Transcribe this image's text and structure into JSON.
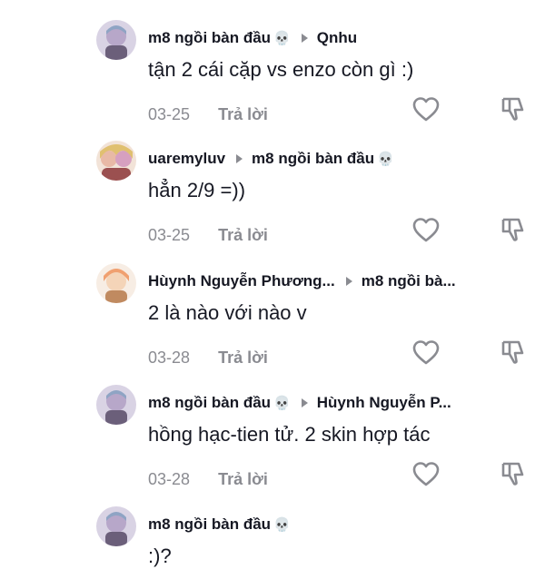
{
  "comments": [
    {
      "author": "m8 ngồi bàn đầu",
      "author_skull": "💀",
      "reply_to": "Qnhu",
      "reply_to_skull": "",
      "text": "tận 2 cái cặp vs enzo còn gì :)",
      "date": "03-25",
      "reply_label": "Trả lời",
      "avatar_color": "#b7a7c9"
    },
    {
      "author": "uaremyluv",
      "author_skull": "",
      "reply_to": "m8 ngồi bàn đầu",
      "reply_to_skull": "💀",
      "text": "hẳn 2/9 =))",
      "date": "03-25",
      "reply_label": "Trả lời",
      "avatar_color": "#e8b9a6"
    },
    {
      "author": "Hùynh Nguyễn Phương...",
      "author_skull": "",
      "reply_to": "m8 ngồi bà...",
      "reply_to_skull": "",
      "text": "2 là nào với nào v",
      "date": "03-28",
      "reply_label": "Trả lời",
      "avatar_color": "#f0c49a"
    },
    {
      "author": "m8 ngồi bàn đầu",
      "author_skull": "💀",
      "reply_to": "Hùynh Nguyễn P...",
      "reply_to_skull": "",
      "text": "hồng hạc-tien tử. 2 skin hợp tác",
      "date": "03-28",
      "reply_label": "Trả lời",
      "avatar_color": "#b7a7c9"
    },
    {
      "author": "m8 ngồi bàn đầu",
      "author_skull": "💀",
      "reply_to": "",
      "reply_to_skull": "",
      "text": ":)?",
      "date": "",
      "reply_label": "",
      "avatar_color": "#b7a7c9"
    }
  ],
  "icons": {
    "like": "heart-outline-icon",
    "dislike": "thumbs-down-outline-icon"
  },
  "colors": {
    "text": "#161823",
    "muted": "#8a8b91",
    "background": "#ffffff"
  }
}
